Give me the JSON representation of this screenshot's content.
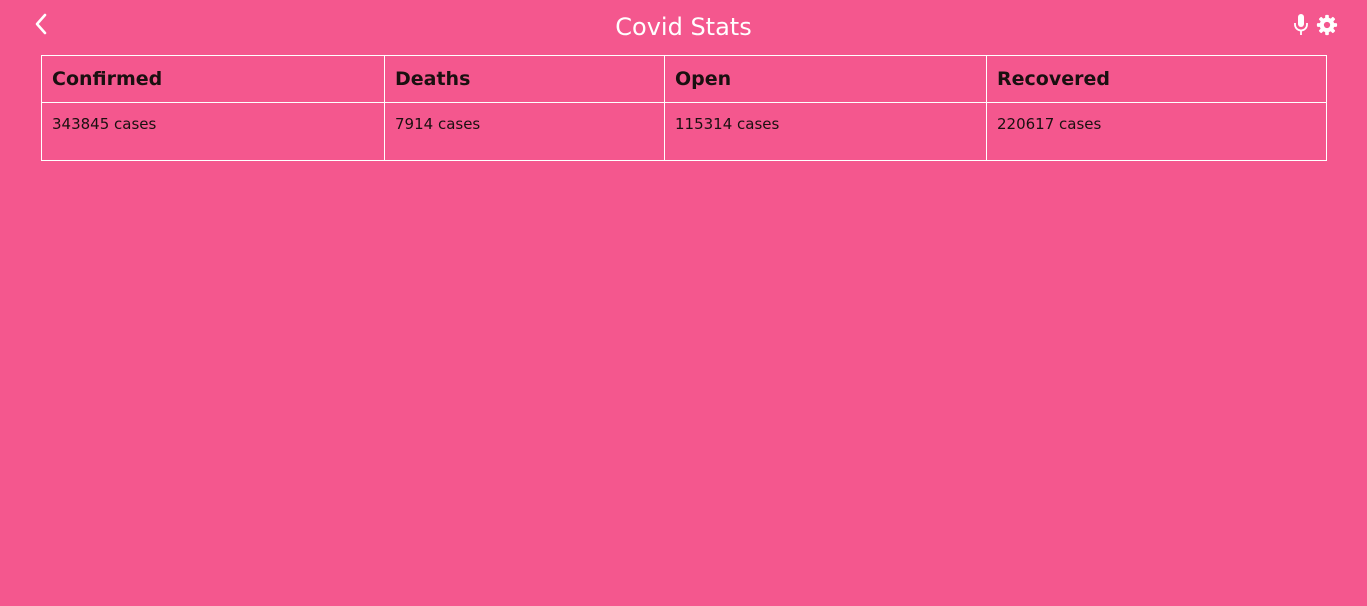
{
  "app": {
    "title": "Covid Stats"
  },
  "toolbar": {
    "back_icon": "chevron-left-icon",
    "mic_icon": "microphone-icon",
    "settings_icon": "gear-icon"
  },
  "colors": {
    "background": "#f4578e",
    "text_light": "#ffffff",
    "text_dark": "#1a1010",
    "border": "#ffffff"
  },
  "table": {
    "headers": [
      "Confirmed",
      "Deaths",
      "Open",
      "Recovered"
    ],
    "rows": [
      [
        "343845 cases",
        "7914 cases",
        "115314 cases",
        "220617 cases"
      ]
    ]
  }
}
